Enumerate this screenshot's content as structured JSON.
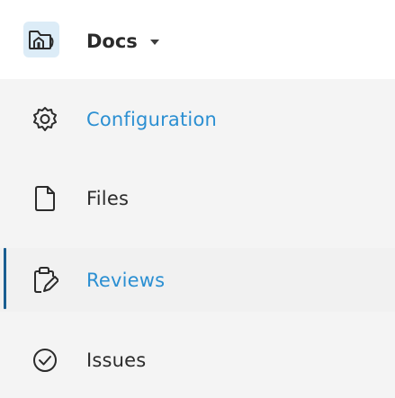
{
  "header": {
    "title": "Docs",
    "icon": "folder-home-icon",
    "dropdown_icon": "caret-down-icon"
  },
  "menu": {
    "items": [
      {
        "label": "Configuration",
        "icon": "gear-icon",
        "highlighted": true,
        "selected": false
      },
      {
        "label": "Files",
        "icon": "file-icon",
        "highlighted": false,
        "selected": false
      },
      {
        "label": "Reviews",
        "icon": "clipboard-edit-icon",
        "highlighted": true,
        "selected": true
      },
      {
        "label": "Issues",
        "icon": "check-circle-icon",
        "highlighted": false,
        "selected": false
      }
    ]
  },
  "colors": {
    "accent": "#2b8fd2",
    "active_indicator": "#1a5e91",
    "icon_dark": "#2b2b2b",
    "header_icon_bg": "#dcecf7",
    "list_bg": "#f4f4f4"
  }
}
